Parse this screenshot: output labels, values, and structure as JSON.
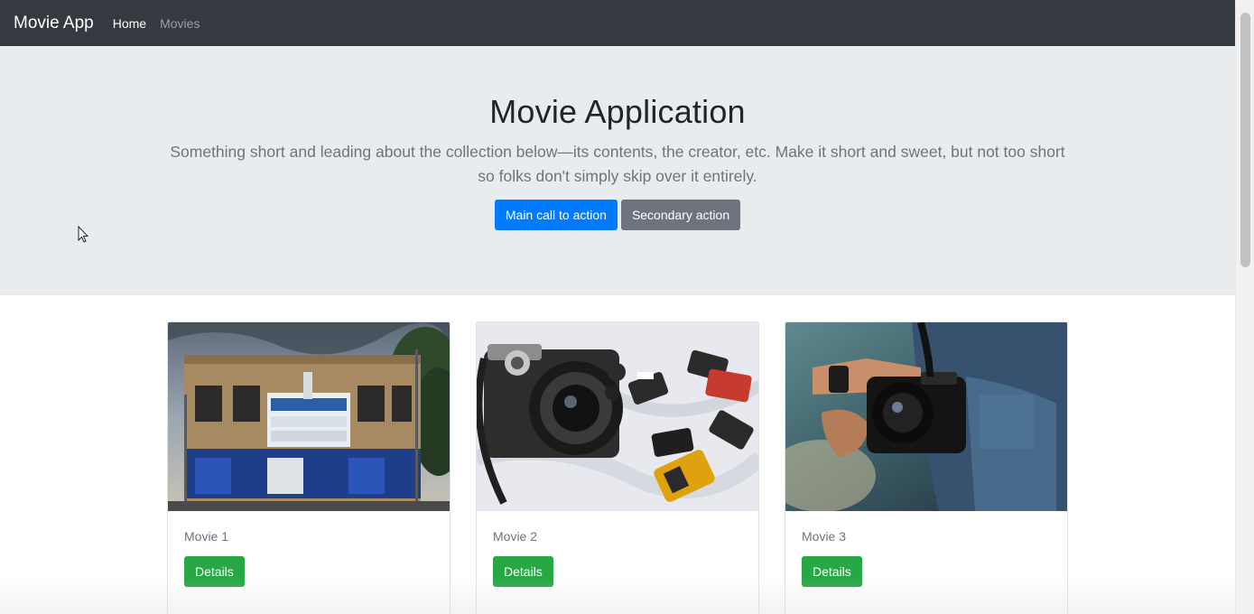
{
  "navbar": {
    "brand": "Movie App",
    "links": [
      {
        "label": "Home",
        "active": true
      },
      {
        "label": "Movies",
        "active": false
      }
    ]
  },
  "hero": {
    "title": "Movie Application",
    "lead": "Something short and leading about the collection below—its contents, the creator, etc. Make it short and sweet, but not too short so folks don't simply skip over it entirely.",
    "primary_button": "Main call to action",
    "secondary_button": "Secondary action"
  },
  "cards": [
    {
      "title": "Movie 1",
      "button": "Details",
      "image": "theater-facade-photo"
    },
    {
      "title": "Movie 2",
      "button": "Details",
      "image": "cameras-and-film-rolls-photo"
    },
    {
      "title": "Movie 3",
      "button": "Details",
      "image": "person-holding-camera-photo"
    }
  ],
  "colors": {
    "navbar": "#343a40",
    "hero_bg": "#e9ecef",
    "primary": "#007bff",
    "secondary": "#6c757d",
    "success": "#28a745"
  }
}
